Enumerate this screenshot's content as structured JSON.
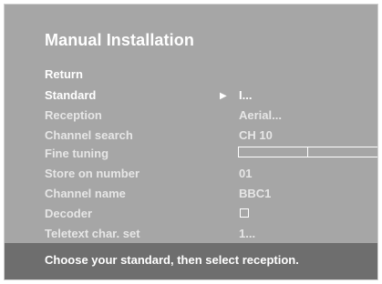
{
  "title": "Manual Installation",
  "menu": {
    "return": "Return",
    "standard": {
      "label": "Standard",
      "value": "I..."
    },
    "reception": {
      "label": "Reception",
      "value": "Aerial..."
    },
    "channel_search": {
      "label": "Channel search",
      "value": "CH 10"
    },
    "fine_tuning": {
      "label": "Fine tuning",
      "level": 0.5
    },
    "store_on_number": {
      "label": "Store on number",
      "value": "01"
    },
    "channel_name": {
      "label": "Channel name",
      "value": "BBC1"
    },
    "decoder": {
      "label": "Decoder",
      "checked": false
    },
    "teletext": {
      "label": "Teletext char. set",
      "value": "1..."
    }
  },
  "footer": "Choose your standard, then select reception.",
  "icons": [
    "right-arrow-icon",
    "checkbox-icon"
  ],
  "colors": {
    "background": "#a6a6a6",
    "footer": "#6e6e6e",
    "text": "#ffffff"
  }
}
